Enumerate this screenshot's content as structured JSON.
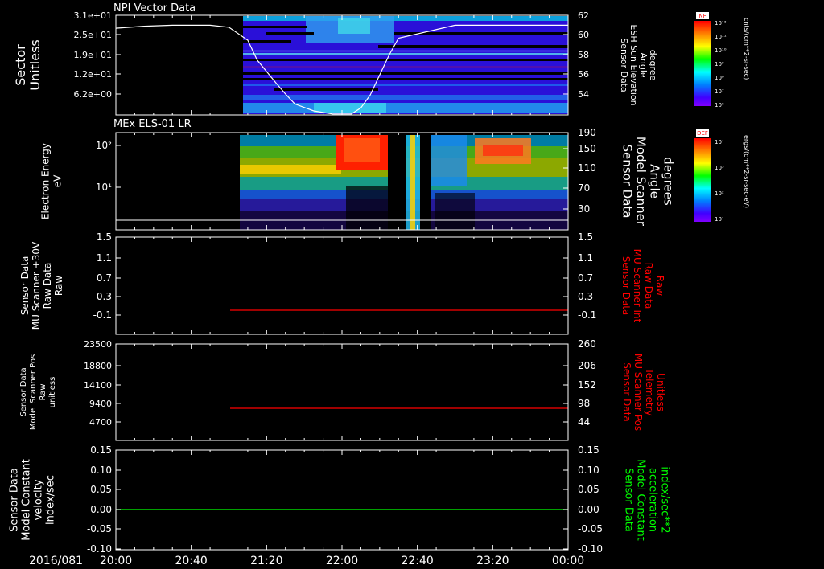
{
  "date_label": "2016/081",
  "time_ticks": [
    "20:00",
    "20:40",
    "21:20",
    "22:00",
    "22:40",
    "23:20",
    "00:00"
  ],
  "colors": {
    "white": "#ffffff",
    "red": "#ff0000",
    "green": "#00ff00"
  },
  "panels": [
    {
      "id": "npi",
      "title": "NPI Vector Data",
      "left_label": [
        "Sector",
        "Unitless"
      ],
      "left_ticks": [
        "3.1e+01",
        "2.5e+01",
        "1.9e+01",
        "1.2e+01",
        "6.2e+00"
      ],
      "right_label": [
        "Sensor Data",
        "ESH Sun Elevation",
        "Angle",
        "degree"
      ],
      "right_ticks": [
        "62",
        "60",
        "58",
        "56",
        "54"
      ],
      "colorbar": {
        "tag": "NF",
        "unit": "cnts/(cm**2-sr-sec)",
        "tick_labels": [
          "10¹²",
          "10¹¹",
          "10¹⁰",
          "10⁹",
          "10⁸",
          "10⁷",
          "10⁶"
        ]
      }
    },
    {
      "id": "els",
      "title": "MEx ELS-01 LR",
      "left_label": [
        "Electron Energy",
        "eV"
      ],
      "left_ticks": [
        "10²",
        "10¹"
      ],
      "right_label": [
        "Sensor Data",
        "Model Scanner",
        "Angle",
        "degrees"
      ],
      "right_ticks": [
        "190",
        "150",
        "110",
        "70",
        "30"
      ],
      "colorbar": {
        "tag": "DEF",
        "unit": "ergs/(cm**2-sr-sec-eV)",
        "tick_labels": [
          "10⁴",
          "10³",
          "10²",
          "10¹"
        ]
      }
    },
    {
      "id": "raw",
      "left_label": [
        "Sensor Data",
        "MU Scanner +30V",
        "Raw Data",
        "Raw"
      ],
      "left_ticks": [
        "1.5",
        "1.1",
        "0.7",
        "0.3",
        "-0.1"
      ],
      "right_label": [
        "Sensor Data",
        "MU Scanner Int",
        "Raw Data",
        "Raw"
      ],
      "right_ticks": [
        "1.5",
        "1.1",
        "0.7",
        "0.3",
        "-0.1"
      ]
    },
    {
      "id": "pos",
      "left_label": [
        "Sensor Data",
        "Model Scanner Pos",
        "Raw",
        "unitless"
      ],
      "left_ticks": [
        "23500",
        "18800",
        "14100",
        "9400",
        "4700"
      ],
      "right_label": [
        "Sensor Data",
        "MU Scanner Pos",
        "Telemetry",
        "Unitless"
      ],
      "right_ticks": [
        "260",
        "206",
        "152",
        "98",
        "44"
      ]
    },
    {
      "id": "vel",
      "left_label": [
        "Sensor Data",
        "Model Constant",
        "velocity",
        "index/sec"
      ],
      "left_ticks": [
        "0.15",
        "0.10",
        "0.05",
        "0.00",
        "-0.05",
        "-0.10"
      ],
      "right_label": [
        "Sensor Data",
        "Model Constant",
        "acceleration",
        "index/sec**2"
      ],
      "right_ticks": [
        "0.15",
        "0.10",
        "0.05",
        "0.00",
        "-0.05",
        "-0.10"
      ]
    }
  ],
  "chart_data": [
    {
      "type": "heatmap",
      "title": "NPI Vector Data",
      "x_range": [
        "20:00",
        "00:00"
      ],
      "ylabel": "Sector Unitless",
      "ylim": [
        0,
        31
      ],
      "data_start": "21:08",
      "overlay_line": {
        "ylabel": "ESH Sun Elevation Angle degree",
        "ylim": [
          52,
          62
        ],
        "x": [
          "20:00",
          "20:15",
          "20:30",
          "20:50",
          "21:00",
          "21:10",
          "21:15",
          "21:25",
          "21:30",
          "21:35",
          "21:45",
          "21:55",
          "22:05",
          "22:10",
          "22:15",
          "22:20",
          "22:25",
          "22:30",
          "23:00",
          "23:30",
          "00:00"
        ],
        "y": [
          60.7,
          60.9,
          61.0,
          61.0,
          60.8,
          59.5,
          57.5,
          55.2,
          54.1,
          53.1,
          52.4,
          52.1,
          52.1,
          52.7,
          54.0,
          56.0,
          58.0,
          59.7,
          61.0,
          61.0,
          61.0
        ]
      }
    },
    {
      "type": "heatmap",
      "title": "MEx ELS-01 LR",
      "x_range": [
        "20:00",
        "00:00"
      ],
      "ylabel": "Electron Energy eV",
      "data_start": "21:05",
      "overlay_line": {
        "ylabel": "Model Scanner Angle degrees",
        "ylim": [
          0,
          190
        ],
        "value": 10
      }
    },
    {
      "type": "line",
      "ylim": [
        -0.3,
        1.5
      ],
      "series": [
        {
          "x": [
            "21:05",
            "00:00"
          ],
          "y": [
            0.0,
            0.0
          ],
          "color": "#ff0000"
        }
      ]
    },
    {
      "type": "line",
      "ylim": [
        0,
        23500
      ],
      "series": [
        {
          "x": [
            "21:05",
            "00:00"
          ],
          "y": [
            7200,
            7200
          ],
          "color": "#ff0000"
        }
      ]
    },
    {
      "type": "line",
      "ylim": [
        -0.1,
        0.15
      ],
      "series": [
        {
          "x": [
            "20:00",
            "00:00"
          ],
          "y": [
            0.0,
            0.0
          ],
          "color": "#00ff00"
        }
      ]
    }
  ]
}
